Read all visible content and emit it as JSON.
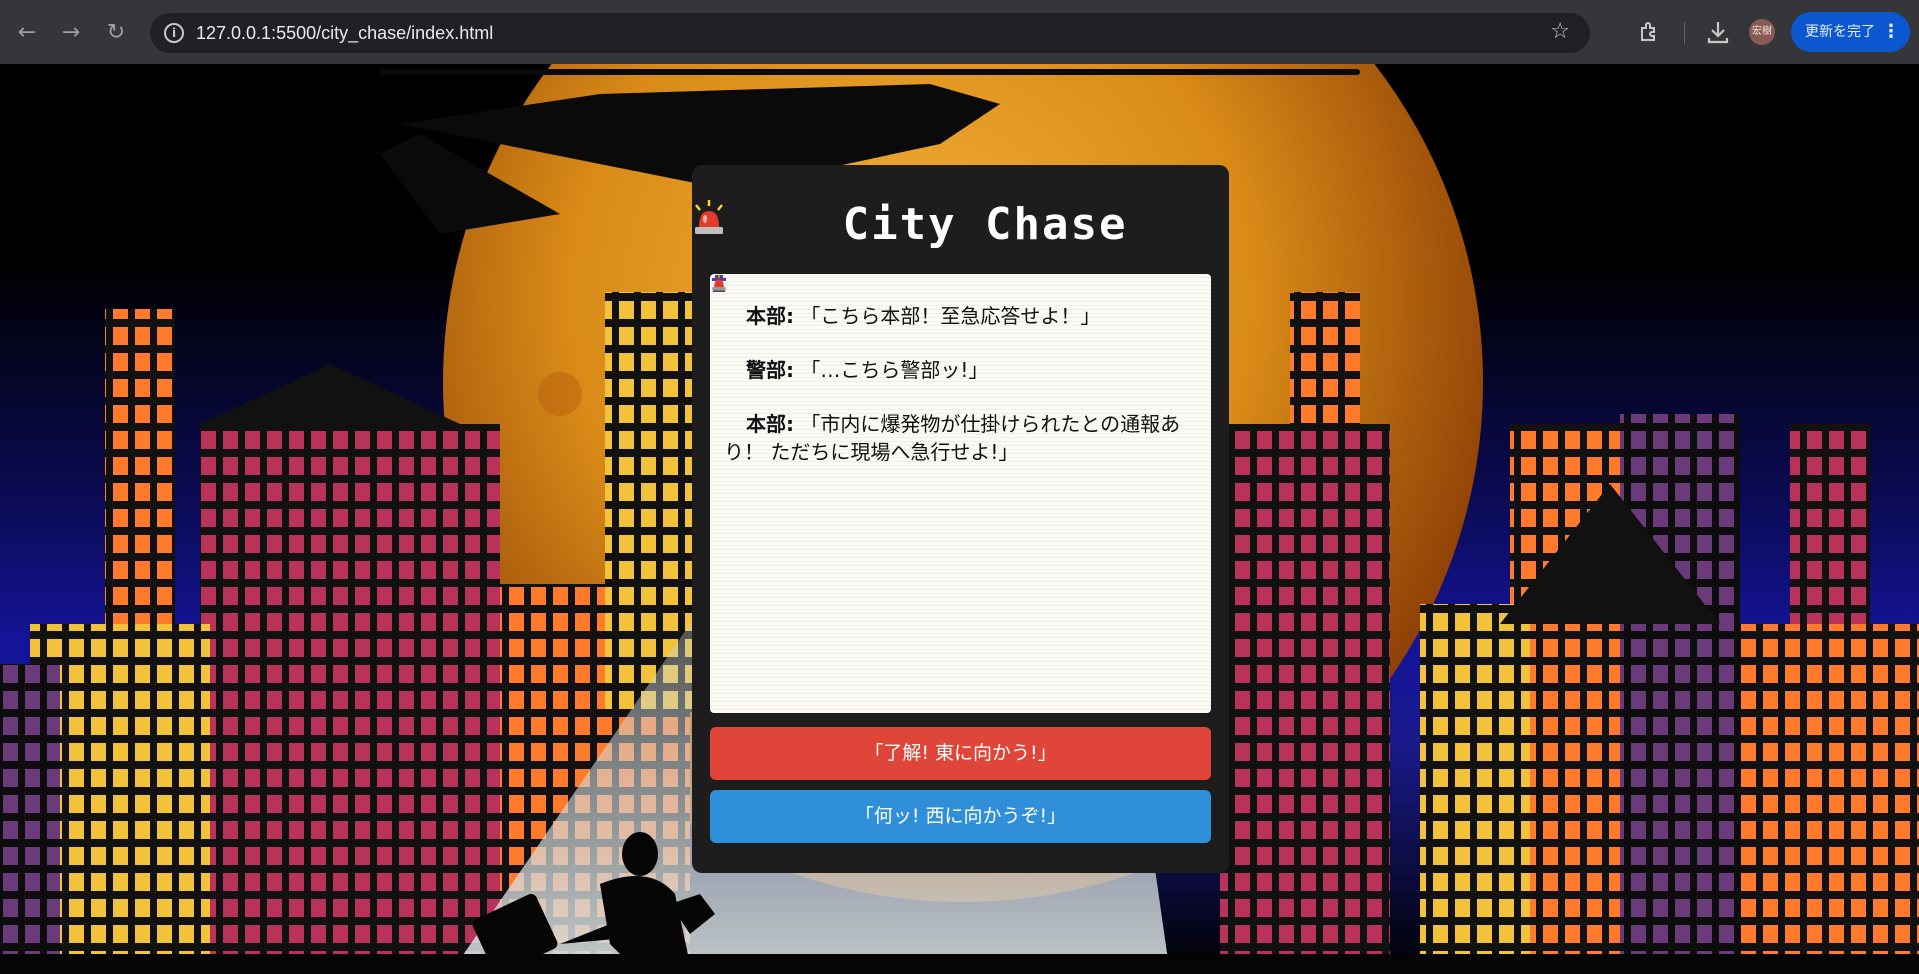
{
  "browser": {
    "back_glyph": "←",
    "forward_glyph": "→",
    "reload_glyph": "↻",
    "url": "127.0.0.1:5500/city_chase/index.html",
    "profile_initials": "宏樹",
    "update_button_label": "更新を完了"
  },
  "game": {
    "title": "City Chase",
    "messages": [
      {
        "speaker": "本部:",
        "icon": "siren-icon",
        "text": "「こちら本部！至急応答せよ！」"
      },
      {
        "speaker": "警部:",
        "icon": "detective-icon",
        "text": "「…こちら警部ッ!」"
      },
      {
        "speaker": "本部:",
        "icon": "siren-icon",
        "text": "「市内に爆発物が仕掛けられたとの通報あり！ ただちに現場へ急行せよ!」"
      }
    ],
    "choices": [
      {
        "label": "「了解! 東に向かう!」",
        "color": "#e0453a"
      },
      {
        "label": "「何ッ! 西に向かうぞ!」",
        "color": "#2f8fd8"
      }
    ]
  },
  "scene": {
    "moon_color": "#d98a17",
    "sky_color": "#14149a"
  }
}
